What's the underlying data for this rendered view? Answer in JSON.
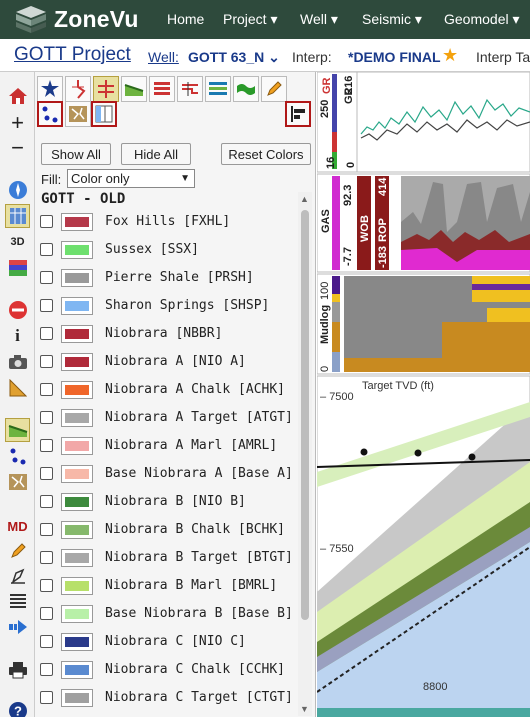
{
  "app": {
    "name": "ZoneVu"
  },
  "nav": {
    "home": "Home",
    "project": "Project ▾",
    "well": "Well ▾",
    "seismic": "Seismic ▾",
    "geomodel": "Geomodel ▾"
  },
  "project": {
    "title": "GOTT Project",
    "well_label": "Well:",
    "well_value": "GOTT 63_N ⌄",
    "interp_label": "Interp:",
    "interp_value": "*DEMO FINAL",
    "interp_tab": "Interp Ta"
  },
  "panel": {
    "show_all": "Show All",
    "hide_all": "Hide All",
    "reset_colors": "Reset Colors",
    "fill_label": "Fill:",
    "fill_value": "Color only",
    "group_title": "GOTT - OLD"
  },
  "formations": [
    {
      "name": "Fox Hills [FXHL]",
      "color": "#b5394a"
    },
    {
      "name": "Sussex [SSX]",
      "color": "#6ee06e"
    },
    {
      "name": "Pierre Shale [PRSH]",
      "color": "#9a9a9a"
    },
    {
      "name": "Sharon Springs [SHSP]",
      "color": "#7fb6f2"
    },
    {
      "name": "Niobrara [NBBR]",
      "color": "#b02a3a"
    },
    {
      "name": "Niobrara A [NIO A]",
      "color": "#b02a3a"
    },
    {
      "name": "Niobrara A Chalk [ACHK]",
      "color": "#f0662a"
    },
    {
      "name": "Niobrara A Target [ATGT]",
      "color": "#a8a8a8"
    },
    {
      "name": "Niobrara A Marl [AMRL]",
      "color": "#f2a8a8"
    },
    {
      "name": "Base Niobrara A [Base A]",
      "color": "#f7b8a8"
    },
    {
      "name": "Niobrara B [NIO B]",
      "color": "#3d8a3d"
    },
    {
      "name": "Niobrara B Chalk [BCHK]",
      "color": "#86b96c"
    },
    {
      "name": "Niobrara B Target [BTGT]",
      "color": "#a8a8a8"
    },
    {
      "name": "Niobrara B Marl [BMRL]",
      "color": "#b7e06a"
    },
    {
      "name": "Base Niobrara B [Base B]",
      "color": "#b8f0a8"
    },
    {
      "name": "Niobrara C [NIO C]",
      "color": "#2a3a8a"
    },
    {
      "name": "Niobrara C Chalk [CCHK]",
      "color": "#5a8ad0"
    },
    {
      "name": "Niobrara C Target [CTGT]",
      "color": "#a0a0a0"
    }
  ],
  "logs": {
    "gr": {
      "label": "GR",
      "label2": "GR",
      "max": "250",
      "min": "0",
      "top": "216",
      "bottom": "16"
    },
    "gas": {
      "label": "GAS",
      "wob_label": "WOB",
      "wob_max": "92.3",
      "wob_min": "-7.7",
      "rop_label": "ROP",
      "rop_max": "414",
      "rop_min": "-183"
    },
    "mudlog": {
      "label": "Mudlog",
      "max": "100",
      "min": "0"
    },
    "section": {
      "title": "Target TVD (ft)",
      "tvd1": "7500",
      "tvd2": "7550",
      "md": "8800"
    }
  },
  "colors": {
    "nav_bg": "#2e4a3c",
    "accent": "#1a3a8a",
    "selected_border": "#b01818"
  }
}
